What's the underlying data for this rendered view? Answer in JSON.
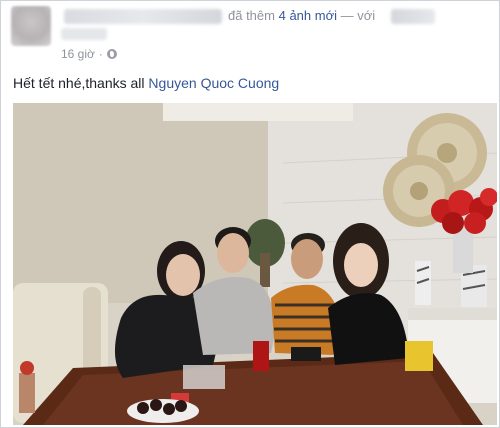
{
  "post": {
    "added_text": "đã thêm",
    "photos_link": "4 ảnh mới",
    "with_text": "— với",
    "time": "16 giờ",
    "separator": "·",
    "message_text": "Hết tết nhé,thanks all",
    "mention": "Nguyen Quoc Cuong"
  },
  "icons": {
    "privacy": "globe-icon"
  },
  "colors": {
    "link": "#365899",
    "meta": "#90949c",
    "text": "#1d2129"
  }
}
